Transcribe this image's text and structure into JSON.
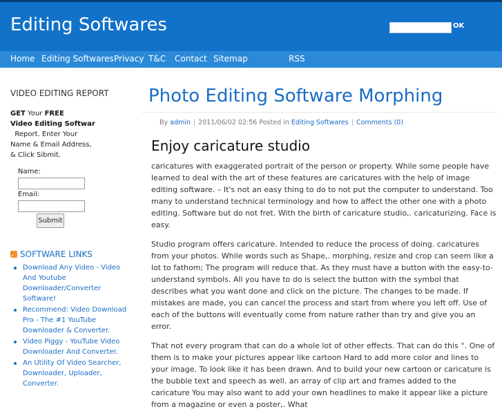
{
  "header": {
    "site_title": "Editing Softwares",
    "search_placeholder": "",
    "search_button": "OK"
  },
  "nav": {
    "items": [
      "Home",
      "Editing Softwares",
      "Privacy",
      "T&C",
      "Contact",
      "Sitemap",
      "RSS"
    ]
  },
  "sidebar": {
    "report_heading": "VIDEO EDITING REPORT",
    "report_line1_prefix": "GET",
    "report_line1_mid": " Your ",
    "report_line1_bold": "FREE",
    "report_line2": "Video Editing Softwar",
    "report_line3": "Report. Enter Your",
    "report_line4": "Name & Email Address,",
    "report_line5": "& Click Sibmit.",
    "name_label": "Name:",
    "email_label": "Email:",
    "submit_label": "Submit",
    "links_heading": "SOFTWARE LINKS",
    "links": [
      "Download Any Video - Video And Youtube Downloader/Converter Software!",
      "Recommend: Video Download Pro - The #1 YouTube Downloader & Converter.",
      "Video Piggy - YouTube Video Downloader And Converter.",
      "An Utility Of Video Searcher, Downloader, Uploader, Converter."
    ]
  },
  "post": {
    "title": "Photo Editing Software Morphing",
    "meta_by": "By",
    "meta_author": "admin",
    "meta_date": "2011/06/02 02:56",
    "meta_posted_in": "Posted in",
    "meta_category": "Editing Softwares",
    "meta_comments": "Comments (0)",
    "heading": "Enjoy caricature studio",
    "paragraphs": [
      "caricatures with exaggerated portrait of the person or property. While some people have learned to deal with the art of these features are caricatures with the help of image editing software. – It's not an easy thing to do to not put the computer to understand. Too many to understand technical terminology and how to affect the other one with a photo editing. Software but do not fret. With the birth of caricature studio,. caricaturizing. Face is easy.",
      "Studio program offers caricature. Intended to reduce the process of doing. caricatures from your photos. While words such as Shape,. morphing, resize and crop can seem like a lot to fathom; The program will reduce that. As they must have a button with the easy-to-understand symbols. All you have to do is select the button with the symbol that describes what you want done and click on the picture. The changes to be made. If mistakes are made, you can cancel the process and start from where you left off. Use of each of the buttons will eventually come from nature rather than try and give you an error.",
      "That not every program that can do a whole lot of other effects. That can do this °. One of them is to make your pictures appear like cartoon Hard to add more color and lines to your image. To look like it has been drawn. And to build your new cartoon or caricature is the bubble text and speech as well. an array of clip art and frames added to the caricature You may also want to add your own headlines to make it appear like a picture from a magazine or even a poster,. What"
    ]
  }
}
